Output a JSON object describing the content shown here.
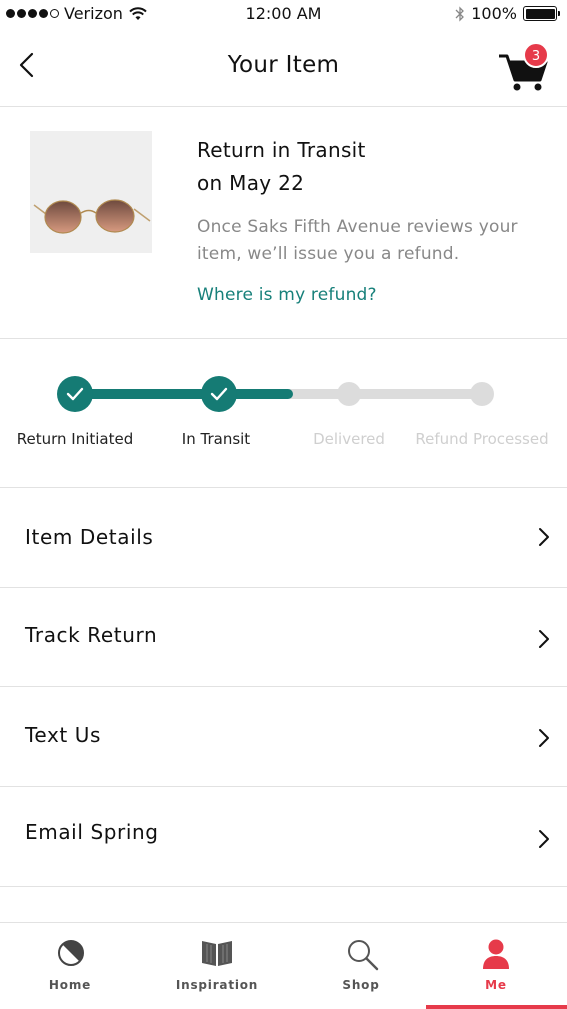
{
  "status_bar": {
    "carrier": "Verizon",
    "time": "12:00 AM",
    "battery": "100%",
    "signal_bars_filled": 4,
    "signal_bars_total": 5
  },
  "header": {
    "title": "Your Item",
    "cart_count": "3",
    "back_icon": "chevron-left-icon",
    "cart_icon": "shopping-cart-icon"
  },
  "item": {
    "status_title": "Return in Transit",
    "status_date": "on May 22",
    "description": "Once Saks Fifth Avenue reviews your item, we’ll issue you a refund.",
    "refund_link": "Where is my refund?",
    "image_icon": "sunglasses-image"
  },
  "progress": {
    "steps": [
      {
        "label": "Return Initiated",
        "state": "done"
      },
      {
        "label": "In Transit",
        "state": "done"
      },
      {
        "label": "Delivered",
        "state": "pending"
      },
      {
        "label": "Refund Processed",
        "state": "pending"
      }
    ],
    "fill_fraction": 0.53
  },
  "menu": {
    "items": [
      {
        "label": "Item Details"
      },
      {
        "label": "Track Return"
      },
      {
        "label": "Text Us"
      },
      {
        "label": "Email Spring"
      }
    ]
  },
  "tab_bar": {
    "tabs": [
      {
        "label": "Home",
        "icon": "home-half-circle-icon",
        "active": false
      },
      {
        "label": "Inspiration",
        "icon": "book-icon",
        "active": false
      },
      {
        "label": "Shop",
        "icon": "search-icon",
        "active": false
      },
      {
        "label": "Me",
        "icon": "person-icon",
        "active": true
      }
    ]
  },
  "colors": {
    "accent_teal": "#157b74",
    "link_teal": "#17807a",
    "active_red": "#e63a4a",
    "inactive_gray": "#dcdcdc"
  }
}
